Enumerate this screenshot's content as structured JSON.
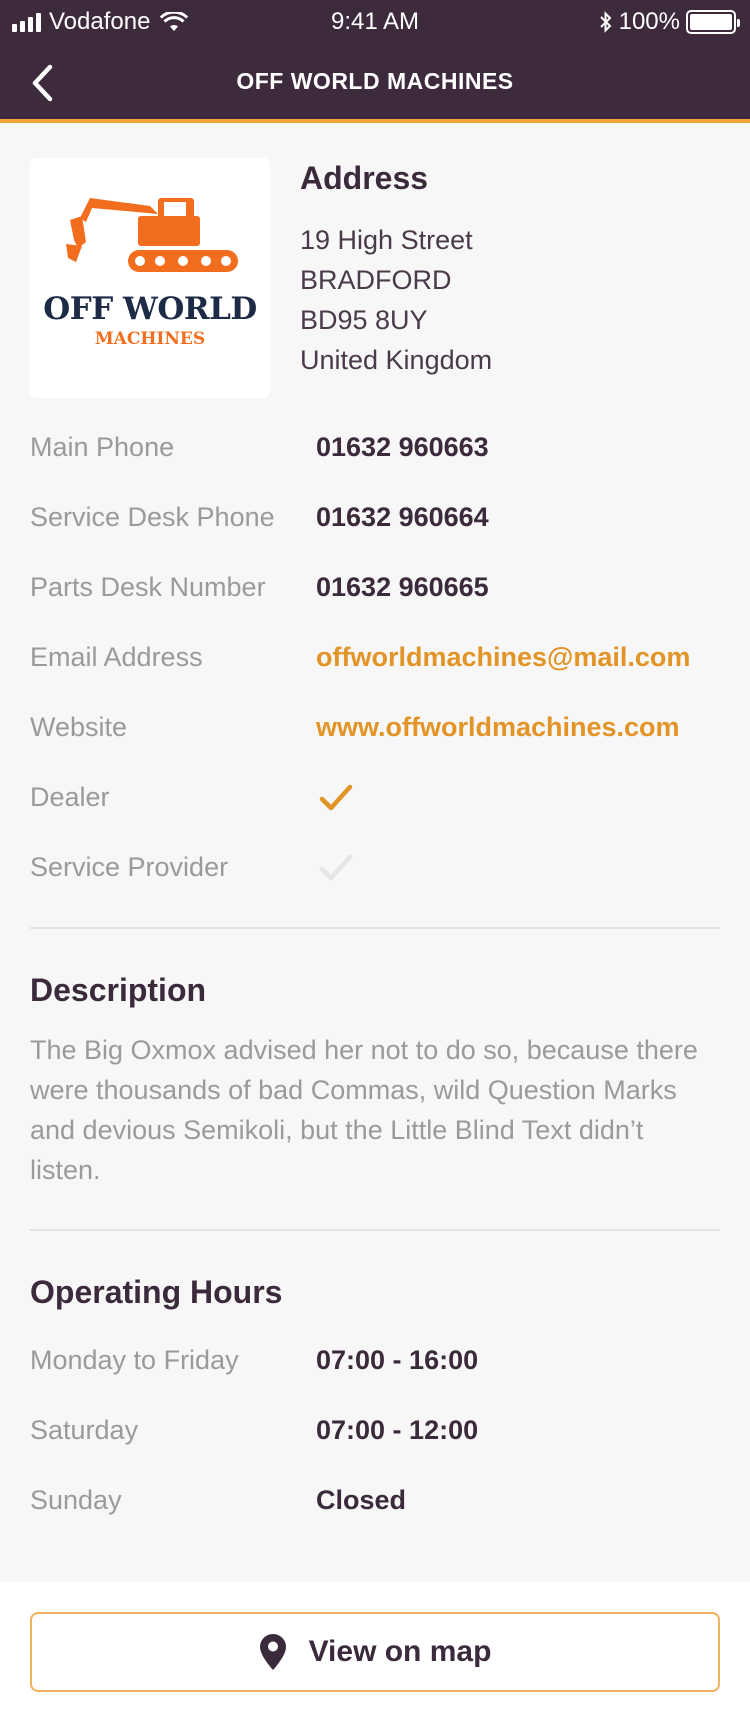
{
  "status_bar": {
    "carrier": "Vodafone",
    "time": "9:41 AM",
    "battery": "100%"
  },
  "header": {
    "title": "OFF WORLD MACHINES"
  },
  "logo": {
    "line1": "OFF WORLD",
    "line2": "MACHINES",
    "icon": "excavator-icon"
  },
  "address": {
    "heading": "Address",
    "lines": [
      "19 High Street",
      "BRADFORD",
      "BD95 8UY",
      "United Kingdom"
    ]
  },
  "contact": [
    {
      "label": "Main Phone",
      "value": "01632 960663"
    },
    {
      "label": "Service Desk Phone",
      "value": "01632 960664"
    },
    {
      "label": "Parts Desk Number",
      "value": "01632 960665"
    },
    {
      "label": "Email Address",
      "value": "offworldmachines@mail.com"
    },
    {
      "label": "Website",
      "value": "www.offworldmachines.com"
    },
    {
      "label": "Dealer",
      "checked": true
    },
    {
      "label": "Service Provider",
      "checked": false
    }
  ],
  "description": {
    "heading": "Description",
    "text": "The Big Oxmox advised her not to do so, because there were thousands of bad Commas, wild Question Marks and devious Semikoli, but the Little Blind Text didn’t listen."
  },
  "hours": {
    "heading": "Operating Hours",
    "rows": [
      {
        "label": "Monday to Friday",
        "value": "07:00 - 16:00"
      },
      {
        "label": "Saturday",
        "value": "07:00 - 12:00"
      },
      {
        "label": "Sunday",
        "value": "Closed"
      }
    ]
  },
  "actions": {
    "view_map": "View on map"
  },
  "colors": {
    "header_bg": "#3d2a3c",
    "accent": "#e39427",
    "text_dark": "#3b2a3b",
    "text_muted": "#9a9a9a"
  }
}
